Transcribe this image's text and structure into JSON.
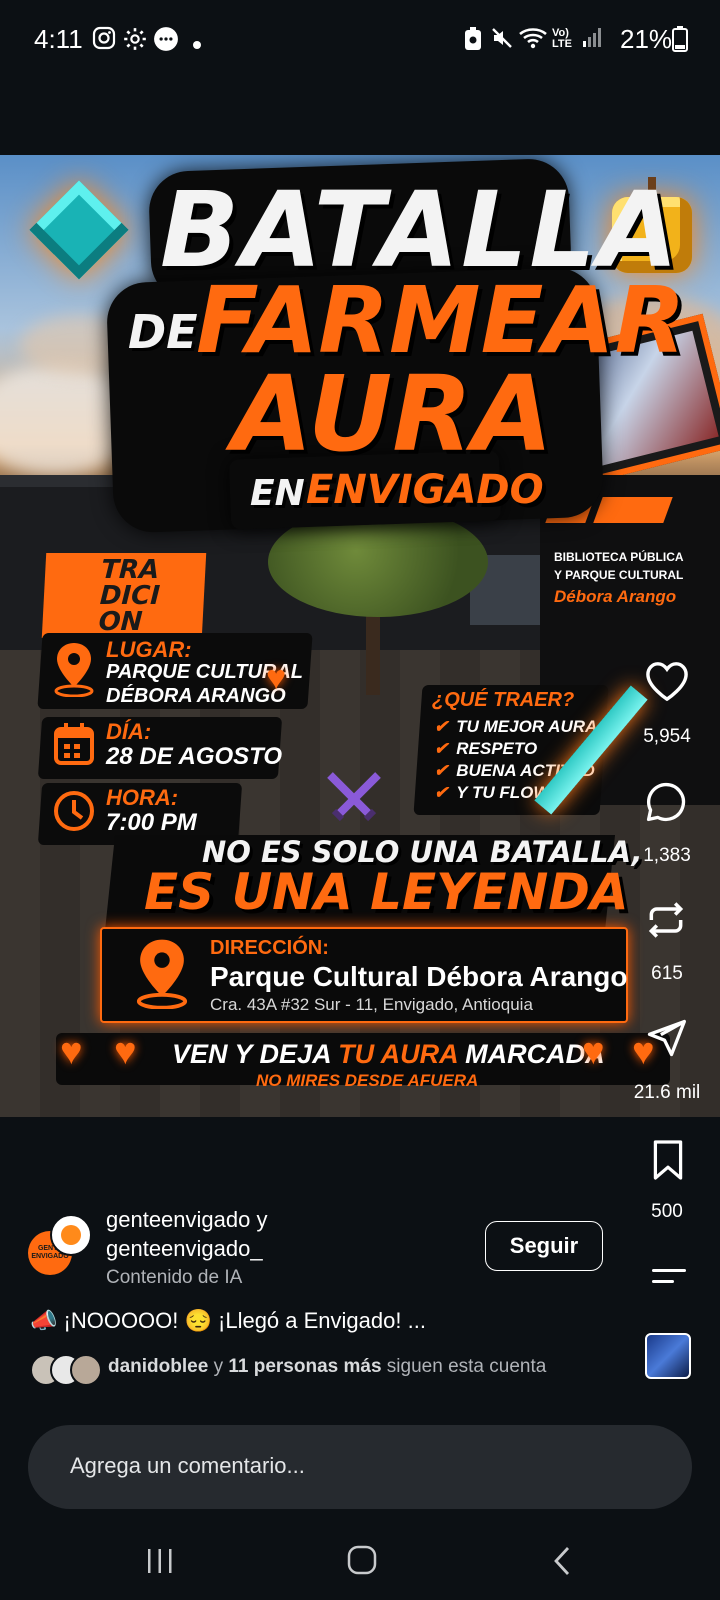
{
  "status_bar": {
    "time": "4:11",
    "battery": "21%"
  },
  "post": {
    "poster": {
      "title_line1": "BATALLA",
      "title_de": "DE",
      "title_line2": "FARMEAR",
      "title_line3": "AURA",
      "subtitle_en": "EN",
      "subtitle_place": "ENVIGADO",
      "banner_text": "TRA DICI ON",
      "sign_text_1": "BIBLIOTECA PÚBLICA",
      "sign_text_2": "Y PARQUE CULTURAL",
      "sign_text_3": "Débora Arango",
      "lugar_label": "LUGAR:",
      "lugar_value_1": "PARQUE CULTURAL",
      "lugar_value_2": "DÉBORA ARANGO",
      "dia_label": "DÍA:",
      "dia_value": "28 DE AGOSTO",
      "hora_label": "HORA:",
      "hora_value": "7:00 PM",
      "traer_title": "¿QUÉ TRAER?",
      "traer_items": [
        "TU MEJOR AURA",
        "RESPETO",
        "BUENA ACTITUD",
        "Y TU FLOW"
      ],
      "tagline_1": "NO ES SOLO UNA BATALLA,",
      "tagline_2": "ES UNA LEYENDA",
      "direccion_label": "DIRECCIÓN:",
      "direccion_name": "Parque Cultural Débora Arango",
      "direccion_address": "Cra. 43A #32 Sur - 11, Envigado, Antioquia",
      "cta_part1": "VEN Y DEJA",
      "cta_part2": "TU AURA",
      "cta_part3": "MARCADA",
      "cta_sub": "NO MIRES DESDE AFUERA"
    },
    "actions": {
      "likes": "5,954",
      "comments": "1,383",
      "reposts": "615",
      "shares": "21.6 mil",
      "saves": "500"
    },
    "author": {
      "avatar_text": "GENTE ENVIGADO",
      "name_line1": "genteenvigado y",
      "name_line2": "genteenvigado_",
      "label": "Contenido de IA",
      "follow_label": "Seguir"
    },
    "caption": "📣 ¡NOOOOO! 😔 ¡Llegó a Envigado! ...",
    "followed_by": {
      "name": "danidoblee",
      "connector": "y",
      "others": "11 personas más",
      "suffix": "siguen esta cuenta"
    }
  },
  "comment_input": {
    "placeholder": "Agrega un comentario..."
  },
  "colors": {
    "accent_orange": "#ff6a10",
    "background": "#0c1014",
    "input_bg": "#262a2f"
  }
}
